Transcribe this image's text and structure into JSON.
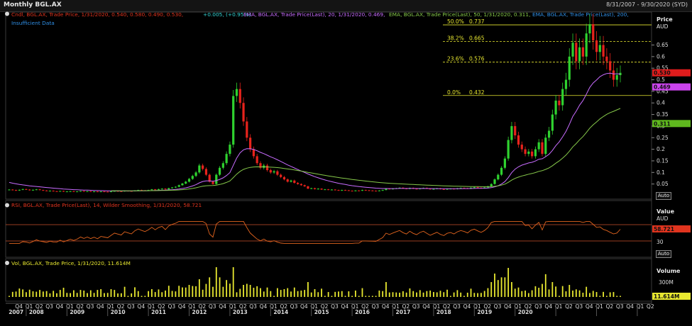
{
  "header": {
    "title": "Monthly BGL.AX",
    "date_range": "8/31/2007 - 9/30/2020 (SYD)"
  },
  "panels": {
    "price": {
      "legend": [
        {
          "text": "Cndl, BGL.AX, Trade Price, 1/31/2020, 0.540, 0.580, 0.490, 0.530,",
          "color": "#e0341e"
        },
        {
          "text": "+0.005, (+0.95%)",
          "color": "#33d6d6"
        },
        {
          "text": "EMA, BGL.AX, Trade Price(Last), 20, 1/31/2020, 0.469,",
          "color": "#c86cff"
        },
        {
          "text": "EMA, BGL.AX, Trade Price(Last), 50, 1/31/2020, 0.311,",
          "color": "#86c94a"
        },
        {
          "text": "EMA, BGL.AX, Trade Price(Last), 200,",
          "color": "#2f8fe6"
        }
      ],
      "legend_line2": "Insufficient Data",
      "axis_title": "Price",
      "axis_unit": "AUD",
      "last_badges": [
        {
          "value": 0.53,
          "label": "0.530",
          "color": "#e01c1c"
        },
        {
          "value": 0.469,
          "label": "0.469",
          "color": "#cc44ee"
        },
        {
          "value": 0.311,
          "label": "0.311",
          "color": "#5fb81e"
        }
      ],
      "auto": "Auto"
    },
    "rsi": {
      "legend": "RSI, BGL.AX, Trade Price(Last), 14, Wilder Smoothing, 1/31/2020, 58.721",
      "axis_title": "Value",
      "axis_unit": "AUD",
      "badge": "58.721",
      "tick": "30",
      "auto": "Auto"
    },
    "volume": {
      "legend": "Vol, BGL.AX, Trade Price, 1/31/2020, 11.614M",
      "axis_title": "Volume",
      "tick": "300M",
      "badge": "11.614M",
      "auto": "Auto"
    }
  },
  "x_axis": {
    "years": [
      "2007",
      "2008",
      "2009",
      "2010",
      "2011",
      "2012",
      "2013",
      "2014",
      "2015",
      "2016",
      "2017",
      "2018",
      "2019",
      "2020"
    ]
  },
  "chart_data": {
    "type": "candlestick",
    "price_ticks": [
      0.05,
      0.1,
      0.15,
      0.2,
      0.25,
      0.3,
      0.35,
      0.4,
      0.45,
      0.5,
      0.55,
      0.6,
      0.65
    ],
    "fibonacci": [
      {
        "label": "50.0%",
        "value": 0.737
      },
      {
        "label": "38.2%",
        "value": 0.665
      },
      {
        "label": "23.6%",
        "value": 0.576
      },
      {
        "label": "0.0%",
        "value": 0.432
      }
    ],
    "close": [
      0.026,
      0.024,
      0.022,
      0.025,
      0.028,
      0.026,
      0.023,
      0.025,
      0.027,
      0.024,
      0.022,
      0.02,
      0.021,
      0.019,
      0.018,
      0.02,
      0.017,
      0.018,
      0.019,
      0.017,
      0.018,
      0.02,
      0.018,
      0.019,
      0.017,
      0.018,
      0.016,
      0.018,
      0.017,
      0.016,
      0.018,
      0.02,
      0.019,
      0.018,
      0.021,
      0.02,
      0.019,
      0.022,
      0.024,
      0.023,
      0.022,
      0.024,
      0.027,
      0.025,
      0.028,
      0.03,
      0.027,
      0.032,
      0.035,
      0.038,
      0.045,
      0.052,
      0.06,
      0.072,
      0.085,
      0.1,
      0.13,
      0.115,
      0.09,
      0.06,
      0.05,
      0.09,
      0.12,
      0.14,
      0.18,
      0.22,
      0.43,
      0.46,
      0.4,
      0.32,
      0.25,
      0.2,
      0.17,
      0.14,
      0.12,
      0.13,
      0.11,
      0.1,
      0.105,
      0.09,
      0.08,
      0.07,
      0.06,
      0.065,
      0.055,
      0.05,
      0.045,
      0.04,
      0.03,
      0.032,
      0.028,
      0.03,
      0.026,
      0.027,
      0.025,
      0.026,
      0.024,
      0.022,
      0.024,
      0.023,
      0.021,
      0.02,
      0.022,
      0.021,
      0.024,
      0.023,
      0.022,
      0.021,
      0.02,
      0.022,
      0.024,
      0.03,
      0.028,
      0.03,
      0.032,
      0.034,
      0.031,
      0.029,
      0.033,
      0.03,
      0.028,
      0.031,
      0.033,
      0.03,
      0.027,
      0.029,
      0.031,
      0.028,
      0.026,
      0.029,
      0.03,
      0.028,
      0.031,
      0.033,
      0.032,
      0.03,
      0.034,
      0.036,
      0.034,
      0.032,
      0.035,
      0.04,
      0.05,
      0.07,
      0.09,
      0.12,
      0.16,
      0.24,
      0.3,
      0.26,
      0.22,
      0.2,
      0.18,
      0.19,
      0.17,
      0.2,
      0.23,
      0.18,
      0.25,
      0.28,
      0.35,
      0.41,
      0.39,
      0.46,
      0.5,
      0.6,
      0.66,
      0.58,
      0.64,
      0.6,
      0.7,
      0.74,
      0.67,
      0.62,
      0.65,
      0.6,
      0.58,
      0.54,
      0.5,
      0.52,
      0.53
    ],
    "ema20_last": 0.469,
    "ema50_last": 0.311,
    "rsi_last": 58.721,
    "volume_last": "11.614M"
  }
}
